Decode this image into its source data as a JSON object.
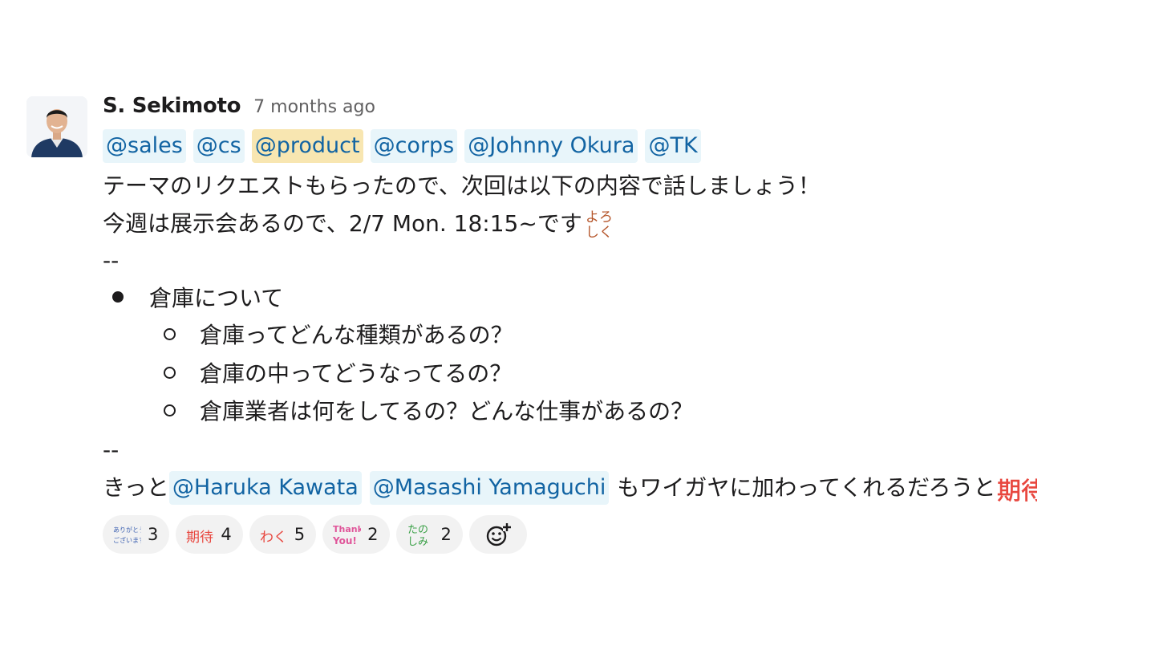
{
  "message": {
    "author": "S. Sekimoto",
    "timestamp": "7 months ago",
    "mentions": [
      {
        "label": "@sales",
        "highlight": false
      },
      {
        "label": "@cs",
        "highlight": false
      },
      {
        "label": "@product",
        "highlight": true
      },
      {
        "label": "@corps",
        "highlight": false
      },
      {
        "label": "@Johnny Okura",
        "highlight": false
      },
      {
        "label": "@TK",
        "highlight": false
      }
    ],
    "line1": "テーマのリクエストもらったので、次回は以下の内容で話しましょう！",
    "line2": "今週は展示会あるので、2/7 Mon. 18:15~です",
    "yoroshiku_emoji": {
      "top": "よろ",
      "bottom": "しく",
      "color": "#b5562b"
    },
    "separator1": "--",
    "bullet": "倉庫について",
    "sub_bullets": [
      "倉庫ってどんな種類があるの？",
      "倉庫の中ってどうなってるの？",
      "倉庫業者は何をしてるの？どんな仕事があるの？"
    ],
    "separator2": "--",
    "closing_prefix": "きっと",
    "closing_mentions": [
      "@Haruka Kawata",
      "@Masashi Yamaguchi"
    ],
    "closing_suffix": "もワイガヤに加わってくれるだろうと",
    "kitai_emoji": {
      "text": "期待",
      "color": "#e8473f"
    }
  },
  "reactions": [
    {
      "emoji": "arigatou-emoji",
      "glyph_top": "ありがとう",
      "glyph_bottom": "ございます",
      "color": "#3a5fb0",
      "count": "3"
    },
    {
      "emoji": "kitai-emoji",
      "glyph_top": "期待",
      "glyph_bottom": "",
      "color": "#e8473f",
      "count": "4"
    },
    {
      "emoji": "waku-emoji",
      "glyph_top": "わく",
      "glyph_bottom": "",
      "color": "#e8473f",
      "count": "5"
    },
    {
      "emoji": "thank-you-emoji",
      "glyph_top": "Thank",
      "glyph_bottom": "You!",
      "color": "#e0569a",
      "count": "2"
    },
    {
      "emoji": "tanoshimi-emoji",
      "glyph_top": "たの",
      "glyph_bottom": "しみ",
      "color": "#3aa047",
      "count": "2"
    }
  ],
  "add_reaction_icon": "add-reaction-icon"
}
